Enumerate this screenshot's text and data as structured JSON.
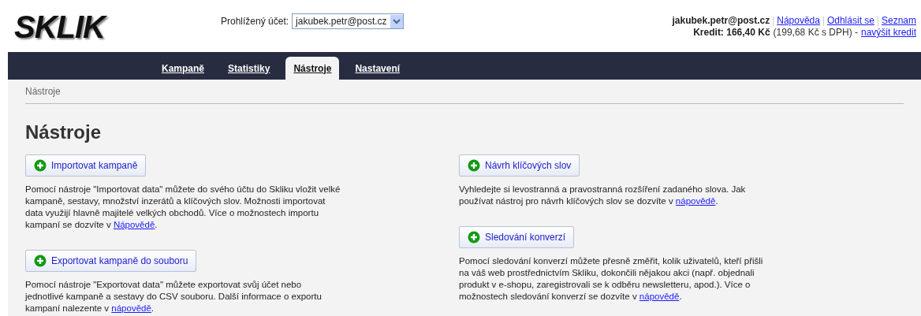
{
  "logo": {
    "text": "SKLIK"
  },
  "account_select": {
    "label": "Prohlížený účet:",
    "value": "jakubek.petr@post.cz"
  },
  "user": {
    "email": "jakubek.petr@post.cz",
    "links": [
      "Nápověda",
      "Odhlásit se",
      "Seznam"
    ],
    "credit_label": "Kredit: 166,40 Kč",
    "credit_note": "(199,68 Kč s DPH) -",
    "credit_link": "navýšit kredit"
  },
  "tabs": [
    {
      "label": "Kampaně",
      "selected": false
    },
    {
      "label": "Statistiky",
      "selected": false
    },
    {
      "label": "Nástroje",
      "selected": true
    },
    {
      "label": "Nastavení",
      "selected": false
    }
  ],
  "breadcrumb": "Nástroje",
  "heading": "Nástroje",
  "columns": [
    [
      {
        "button": "Importovat kampaně",
        "text": "Pomocí nástroje \"Importovat data\" můžete do svého účtu do Skliku vložit velké kampaně, sestavy, množství inzerátů a klíčových slov. Možnosti importovat data využijí hlavně majitelé velkých obchodů. Více o možnostech importu kampaní se dozvíte v ",
        "link": "Nápovědě",
        "after": "."
      },
      {
        "button": "Exportovat kampaně do souboru",
        "text": "Pomocí nástroje \"Exportovat data\" můžete exportovat svůj účet nebo jednotlivé kampaně a sestavy do CSV souboru. Další informace o exportu kampaní nalezente v ",
        "link": "nápovědě",
        "after": "."
      }
    ],
    [
      {
        "button": "Návrh klíčových slov",
        "text": "Vyhledejte si levostranná a pravostranná rozšíření zadaného slova. Jak používat nástroj pro návrh klíčových slov se dozvíte v ",
        "link": "nápovědě",
        "after": "."
      },
      {
        "button": "Sledování konverzí",
        "text": "Pomocí sledování konverzí můžete přesně změřit, kolik uživatelů, kteří přišli na váš web prostřednictvím Skliku, dokončili nějakou akci (např. objednali produkt v e-shopu, zaregistrovali se k odběru newsletteru, apod.). Více o možnostech sledování konverzí se dozvíte v ",
        "link": "nápovědě",
        "after": "."
      }
    ]
  ]
}
